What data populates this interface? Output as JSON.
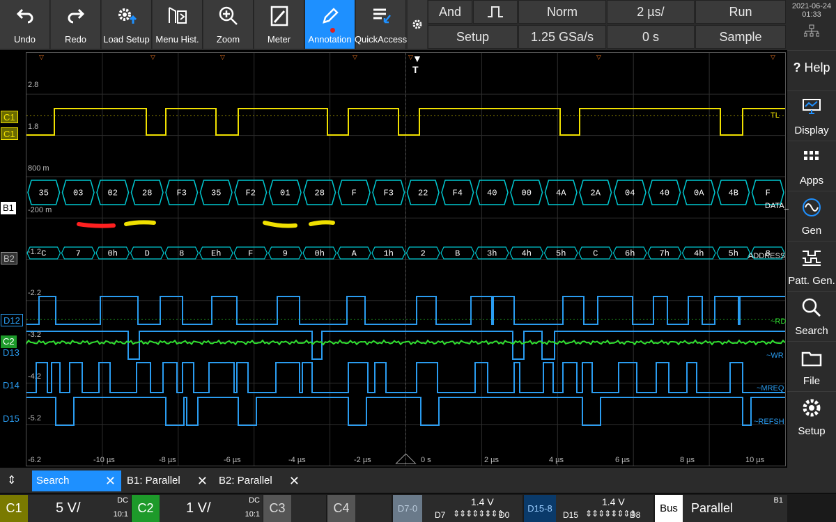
{
  "toolbar": {
    "buttons": [
      {
        "label": "Undo",
        "icon": "undo-arrow-icon"
      },
      {
        "label": "Redo",
        "icon": "redo-arrow-icon"
      },
      {
        "label": "Load Setup",
        "icon": "gear-upload-icon"
      },
      {
        "label": "Menu Hist.",
        "icon": "menu-history-icon"
      },
      {
        "label": "Zoom",
        "icon": "magnifier-plus-icon"
      },
      {
        "label": "Meter",
        "icon": "meter-icon"
      },
      {
        "label": "Annotation",
        "icon": "pen-icon"
      },
      {
        "label": "QuickAccess",
        "icon": "quickaccess-icon"
      }
    ],
    "settings_icon": "gear-icon"
  },
  "trigger": {
    "logic": "And",
    "mode": "Norm",
    "timebase": "2 µs/",
    "run_state": "Run",
    "setup": "Setup",
    "sample_rate": "1.25 GSa/s",
    "offset": "0 s",
    "acq_mode": "Sample"
  },
  "clock": {
    "date": "2021-06-24",
    "time": "01:33"
  },
  "sidebar": [
    {
      "label": "Help",
      "icon": "question-icon"
    },
    {
      "label": "Display",
      "icon": "monitor-icon"
    },
    {
      "label": "Apps",
      "icon": "apps-grid-icon"
    },
    {
      "label": "Gen",
      "icon": "sine-wave-icon"
    },
    {
      "label": "Patt. Gen.",
      "icon": "pattern-icon"
    },
    {
      "label": "Search",
      "icon": "search-icon"
    },
    {
      "label": "File",
      "icon": "folder-icon"
    },
    {
      "label": "Setup",
      "icon": "gear-icon"
    }
  ],
  "channel_tags": [
    "C1",
    "C1",
    "B1",
    "B2",
    "D12",
    "C2",
    "D13",
    "D14",
    "D15"
  ],
  "y_labels": [
    "2.8",
    "1.8",
    "800 m",
    "-200 m",
    "-1.2",
    "-2.2",
    "-3.2",
    "-4.2",
    "-5.2",
    "-6.2"
  ],
  "x_labels": [
    "-10 µs",
    "-8 µs",
    "-6 µs",
    "-4 µs",
    "-2 µs",
    "0 s",
    "2 µs",
    "4 µs",
    "6 µs",
    "8 µs",
    "10 µs"
  ],
  "trace_labels": {
    "c1": "TL",
    "data": "DATA_",
    "address": "ADDRESS",
    "rd": "~RD",
    "wr": "~WR",
    "mreq": "~MREQ",
    "refsh": "~REFSH"
  },
  "bus_b1": [
    "35",
    "03",
    "02",
    "28",
    "F3",
    "35",
    "F2",
    "01",
    "28",
    "F",
    "F3",
    "22",
    "F4",
    "40",
    "00",
    "4A",
    "2A",
    "04",
    "40",
    "0A",
    "4B",
    "F"
  ],
  "bus_b2": [
    "C",
    "7",
    "0h",
    "D",
    "8",
    "Eh",
    "F",
    "9",
    "0h",
    "A",
    "1h",
    "2",
    "B",
    "3h",
    "4h",
    "5h",
    "C",
    "6h",
    "7h",
    "4h",
    "5h",
    "8"
  ],
  "tabs": [
    {
      "label": "Search"
    },
    {
      "label": "B1: Parallel"
    },
    {
      "label": "B2: Parallel"
    }
  ],
  "bottom": {
    "c1": {
      "name": "C1",
      "scale": "5 V/",
      "coupling": "DC",
      "ratio": "10:1"
    },
    "c2": {
      "name": "C2",
      "scale": "1 V/",
      "coupling": "DC",
      "ratio": "10:1"
    },
    "c3": {
      "name": "C3"
    },
    "c4": {
      "name": "C4"
    },
    "d70": {
      "name": "D7-0",
      "thresh": "1.4 V",
      "lo": "D7",
      "hi": "D0"
    },
    "d158": {
      "name": "D15-8",
      "thresh": "1.4 V",
      "lo": "D15",
      "hi": "D8"
    },
    "bus": {
      "name": "Bus",
      "type": "Parallel",
      "id": "B1"
    }
  },
  "colors": {
    "c1": "#f0e000",
    "bus": "#00c8d0",
    "digital": "#2a9cf0",
    "c2": "#30e030",
    "accent": "#1e90ff",
    "c1_tag": "#7a7a00",
    "c2_tag": "#1d9a2a"
  }
}
